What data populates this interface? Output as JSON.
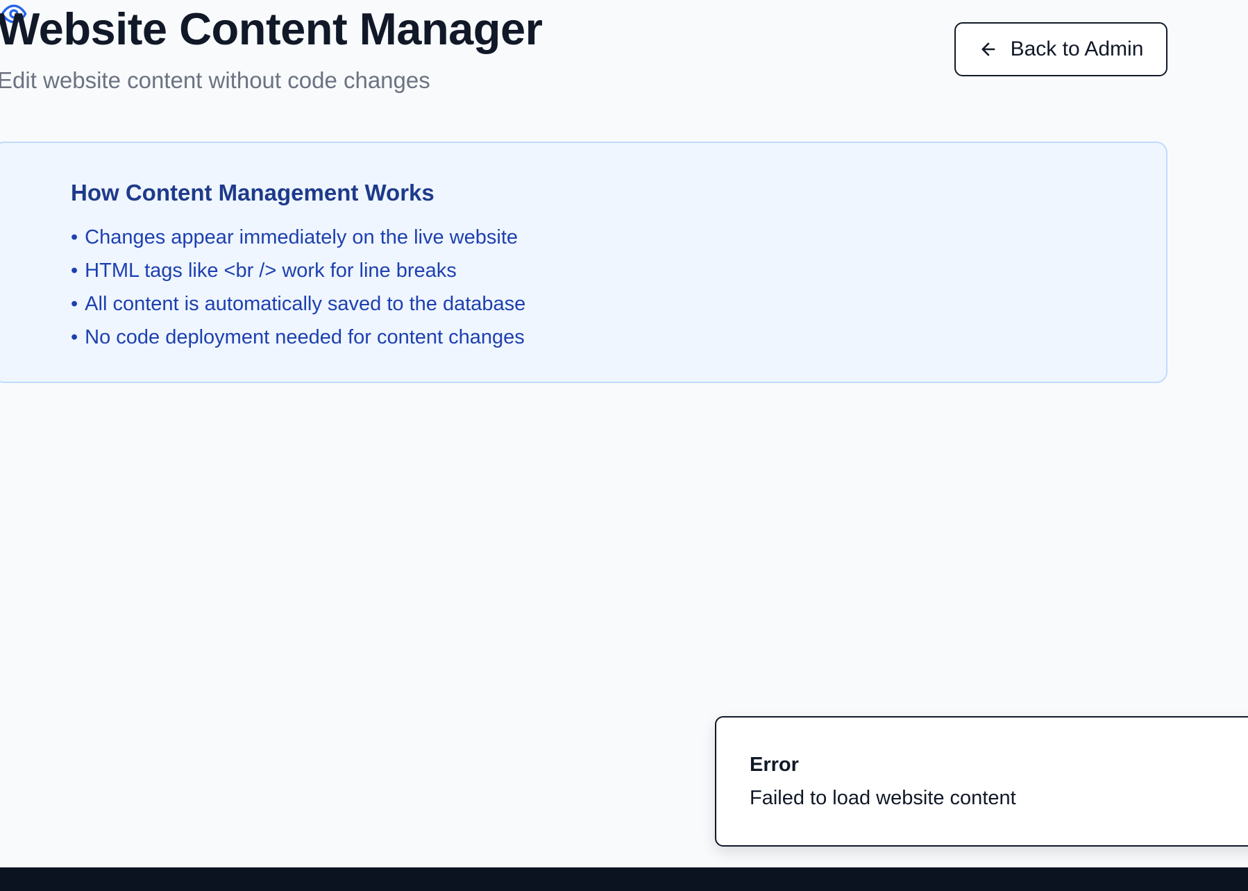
{
  "header": {
    "title": "Website Content Manager",
    "subtitle": "Edit website content without code changes",
    "back_button": {
      "label": "Back to Admin",
      "icon": "arrow-left-icon"
    }
  },
  "info_card": {
    "icon": "eye-icon",
    "heading": "How Content Management Works",
    "items": [
      "Changes appear immediately on the live website",
      "HTML tags like <br /> work for line breaks",
      "All content is automatically saved to the database",
      "No code deployment needed for content changes"
    ]
  },
  "toast": {
    "title": "Error",
    "message": "Failed to load website content"
  },
  "colors": {
    "background": "#f8fafc",
    "card_bg": "#eff6ff",
    "card_border": "#bfdbfe",
    "accent": "#1e40af",
    "heading": "#111827"
  }
}
